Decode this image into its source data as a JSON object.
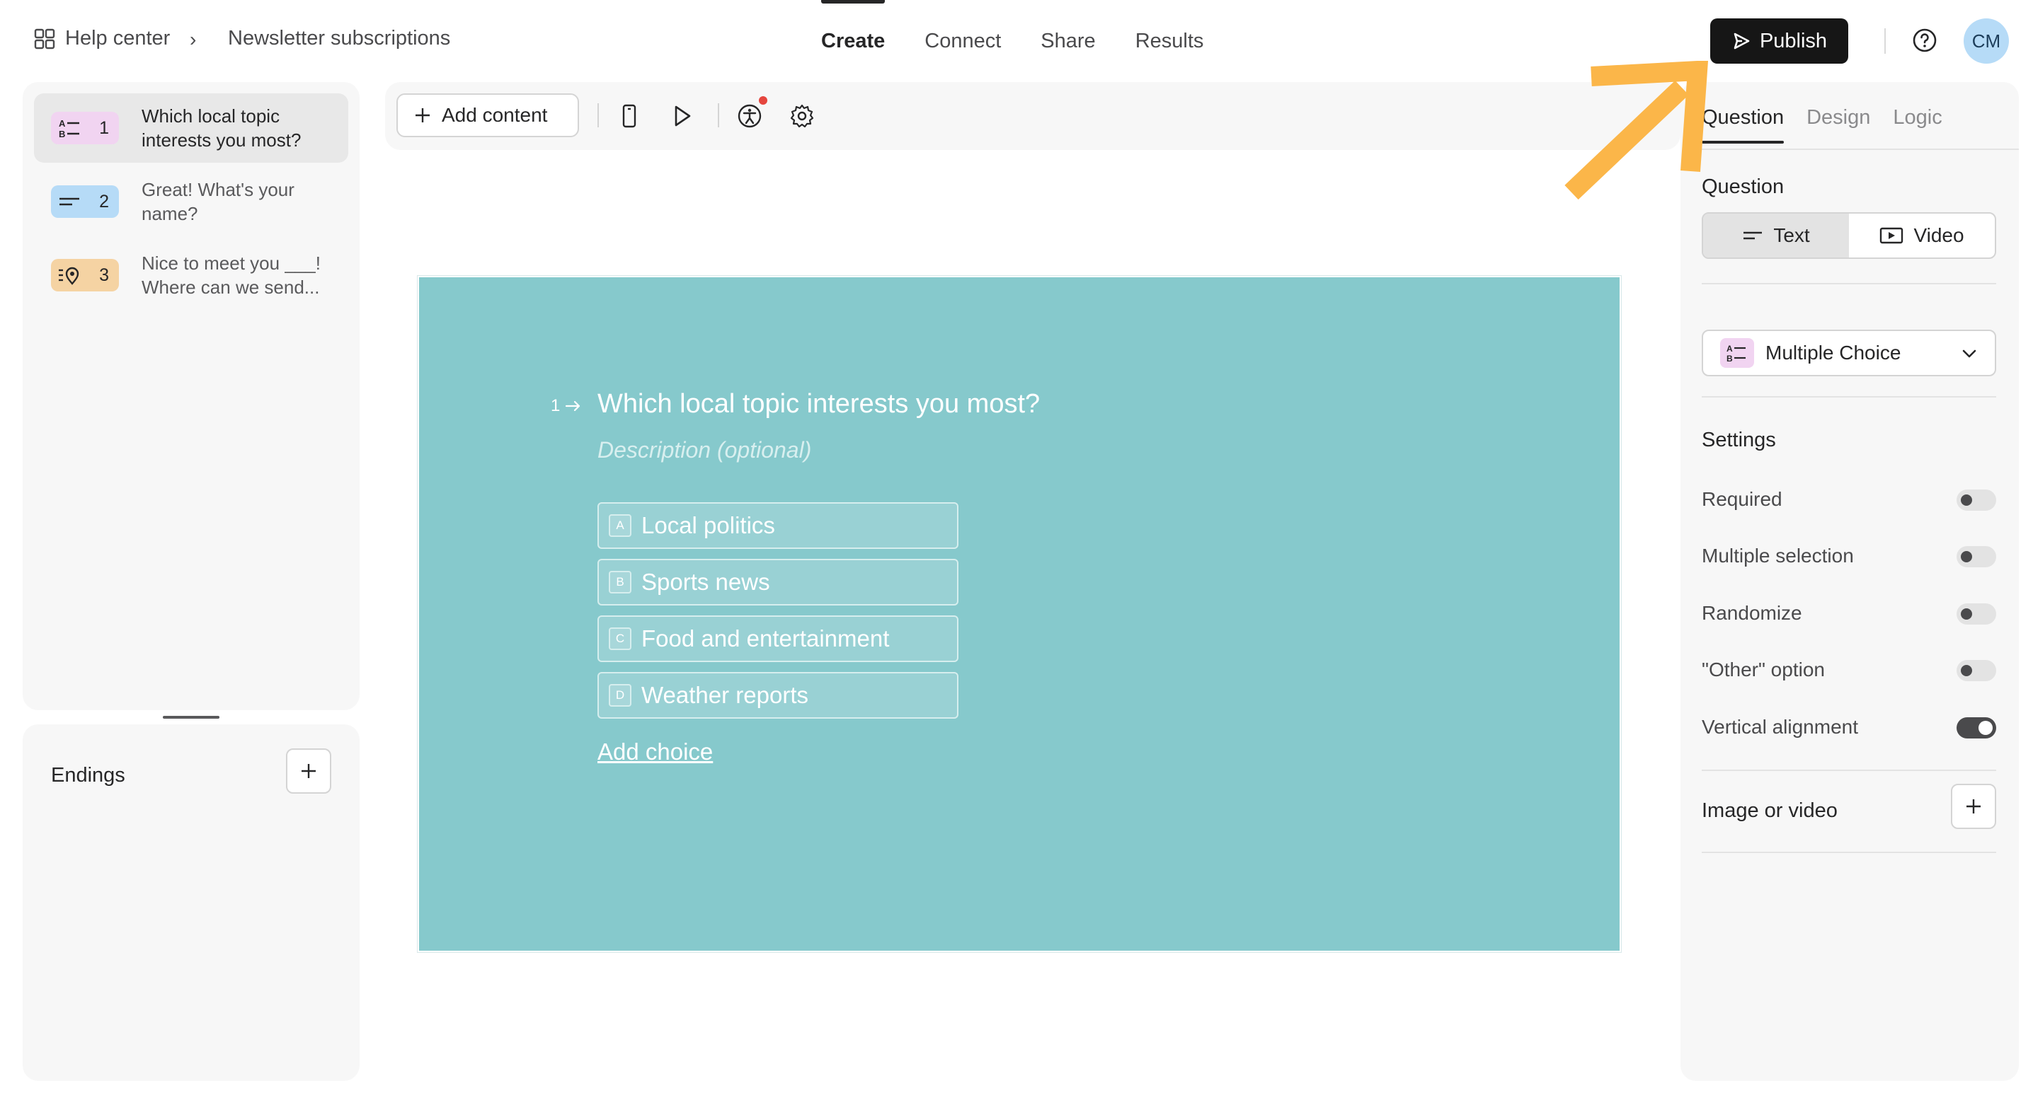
{
  "header": {
    "breadcrumb_home": "Help center",
    "breadcrumb_separator": "›",
    "breadcrumb_page": "Newsletter subscriptions",
    "tabs": [
      {
        "label": "Create",
        "active": true
      },
      {
        "label": "Connect",
        "active": false
      },
      {
        "label": "Share",
        "active": false
      },
      {
        "label": "Results",
        "active": false
      }
    ],
    "publish_label": "Publish",
    "avatar_initials": "CM",
    "help_icon": "question-circle-icon"
  },
  "sidebar": {
    "questions": [
      {
        "number": "1",
        "text": "Which local topic interests you most?",
        "badge_color": "#f1d4f1",
        "icon": "multiple-choice-icon"
      },
      {
        "number": "2",
        "text": "Great! What's your name?",
        "badge_color": "#b6dbf7",
        "icon": "short-text-icon"
      },
      {
        "number": "3",
        "text": "Nice to meet you ___! Where can we send...",
        "badge_color": "#f5d3a3",
        "icon": "contact-info-icon"
      }
    ],
    "endings_label": "Endings"
  },
  "toolbar": {
    "add_content_label": "Add content",
    "icons": [
      "mobile-preview-icon",
      "play-icon",
      "accessibility-icon",
      "settings-gear-icon"
    ]
  },
  "canvas": {
    "background": "#86c9cc",
    "question_number": "1",
    "question_title": "Which local topic interests you most?",
    "description_placeholder": "Description (optional)",
    "choices": [
      {
        "key": "A",
        "label": "Local politics"
      },
      {
        "key": "B",
        "label": "Sports news"
      },
      {
        "key": "C",
        "label": "Food and entertainment"
      },
      {
        "key": "D",
        "label": "Weather reports"
      }
    ],
    "add_choice_label": "Add choice"
  },
  "right_panel": {
    "tabs": [
      {
        "label": "Question",
        "active": true
      },
      {
        "label": "Design",
        "active": false
      },
      {
        "label": "Logic",
        "active": false
      }
    ],
    "question_section_label": "Question",
    "format_options": [
      {
        "label": "Text",
        "active": true
      },
      {
        "label": "Video",
        "active": false
      }
    ],
    "question_type": "Multiple Choice",
    "settings_label": "Settings",
    "settings": [
      {
        "label": "Required",
        "on": false
      },
      {
        "label": "Multiple selection",
        "on": false
      },
      {
        "label": "Randomize",
        "on": false
      },
      {
        "label": "\"Other\" option",
        "on": false
      },
      {
        "label": "Vertical alignment",
        "on": true
      }
    ],
    "media_label": "Image or video"
  },
  "colors": {
    "accent_dark": "#161616",
    "annotation_arrow": "#fbb649",
    "canvas_bg": "#86c9cc",
    "avatar_bg": "#b6dbf7"
  }
}
